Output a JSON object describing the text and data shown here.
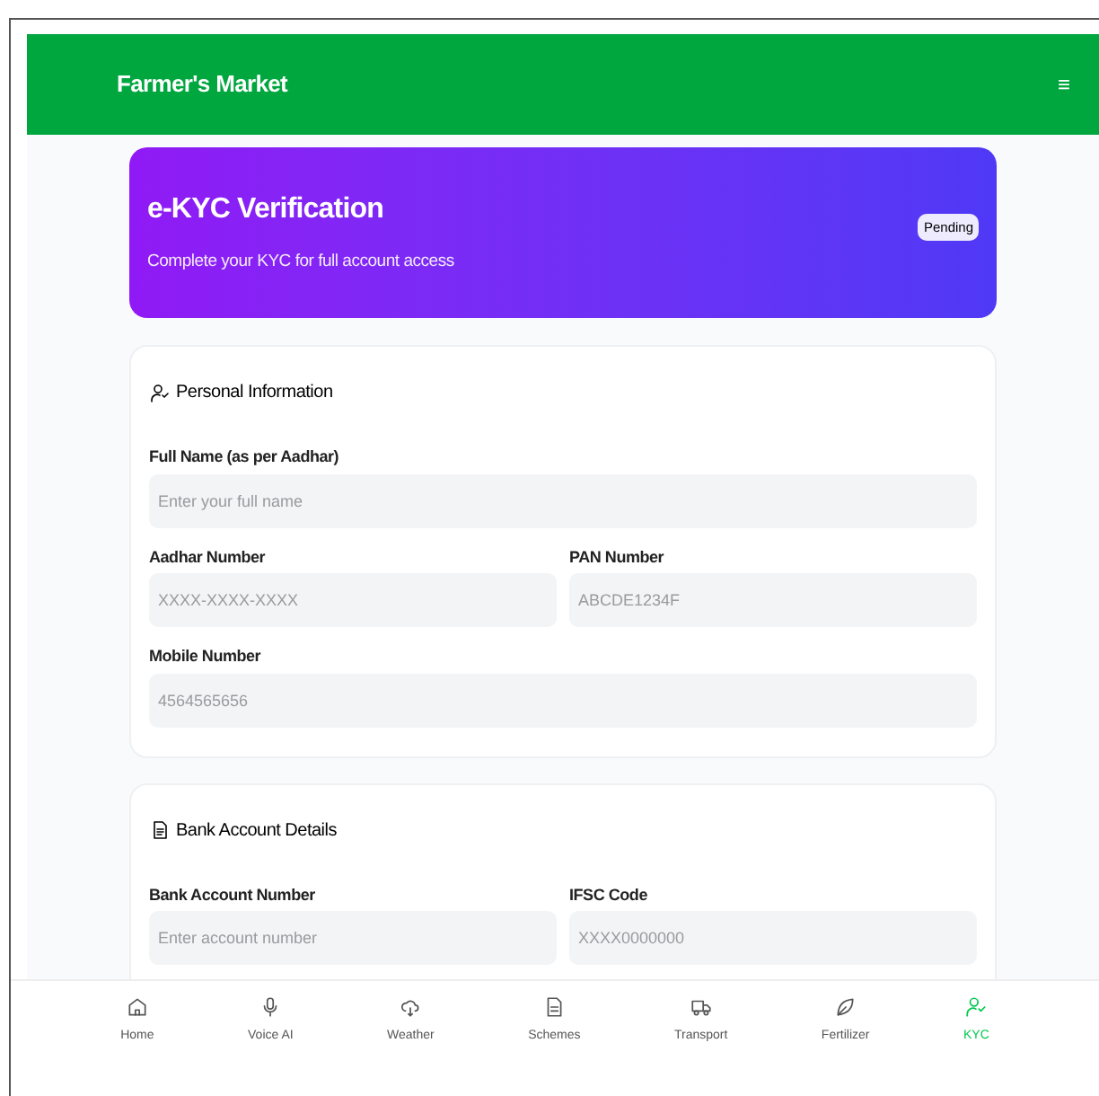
{
  "header": {
    "title": "Farmer's Market",
    "menu_glyph": "≡"
  },
  "banner": {
    "title": "e-KYC Verification",
    "subtitle": "Complete your KYC for full account access",
    "badge": "Pending"
  },
  "sections": [
    {
      "kind": "person",
      "title": "Personal Information",
      "rows": [
        [
          {
            "label": "Full Name (as per Aadhar)",
            "placeholder": "Enter your full name"
          }
        ],
        [
          {
            "label": "Aadhar Number",
            "placeholder": "XXXX-XXXX-XXXX"
          },
          {
            "label": "PAN Number",
            "placeholder": "ABCDE1234F"
          }
        ],
        [
          {
            "label": "Mobile Number",
            "placeholder": "4564565656"
          }
        ]
      ]
    },
    {
      "kind": "bank",
      "title": "Bank Account Details",
      "rows": [
        [
          {
            "label": "Bank Account Number",
            "placeholder": "Enter account number"
          },
          {
            "label": "IFSC Code",
            "placeholder": "XXXX0000000"
          }
        ]
      ]
    }
  ],
  "nav": [
    {
      "kind": "home",
      "label": "Home",
      "selected": false
    },
    {
      "kind": "mic",
      "label": "Voice AI",
      "selected": false
    },
    {
      "kind": "cloud",
      "label": "Weather",
      "selected": false
    },
    {
      "kind": "doc",
      "label": "Schemes",
      "selected": false
    },
    {
      "kind": "truck",
      "label": "Transport",
      "selected": false
    },
    {
      "kind": "leaf",
      "label": "Fertilizer",
      "selected": false
    },
    {
      "kind": "person",
      "label": "KYC",
      "selected": true
    }
  ]
}
